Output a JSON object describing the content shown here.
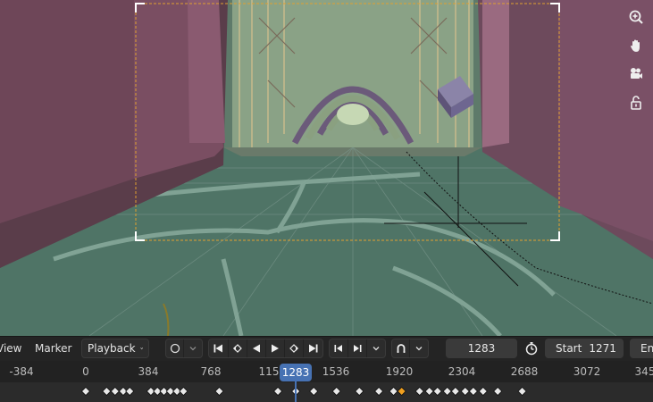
{
  "viewport": {
    "navigation": [
      {
        "icon": "zoom-icon"
      },
      {
        "icon": "hand-pan-icon"
      },
      {
        "icon": "camera-view-icon"
      },
      {
        "icon": "lock-icon"
      }
    ],
    "colors": {
      "camera_frame": "#e0a030",
      "floor": "#4f7466",
      "walls": "#7a4a5c"
    }
  },
  "timeline": {
    "menu": {
      "view_label": "View",
      "marker_label": "Marker",
      "playback_label": "Playback"
    },
    "current_frame": "1283",
    "start_label": "Start",
    "start_value": "1271",
    "end_label": "En",
    "ruler_ticks": [
      "-384",
      "0",
      "384",
      "768",
      "115",
      "1536",
      "1920",
      "2304",
      "2688",
      "3072",
      "345"
    ],
    "keyframe_frames": [
      0,
      128,
      180,
      230,
      270,
      400,
      440,
      480,
      520,
      560,
      600,
      820,
      1180,
      1290,
      1400,
      1540,
      1680,
      1800,
      1890,
      1940,
      2050,
      2110,
      2160,
      2220,
      2270,
      2330,
      2380,
      2440,
      2530,
      2680
    ],
    "selected_keyframe": 1940,
    "accent_color": "#4772b3"
  }
}
